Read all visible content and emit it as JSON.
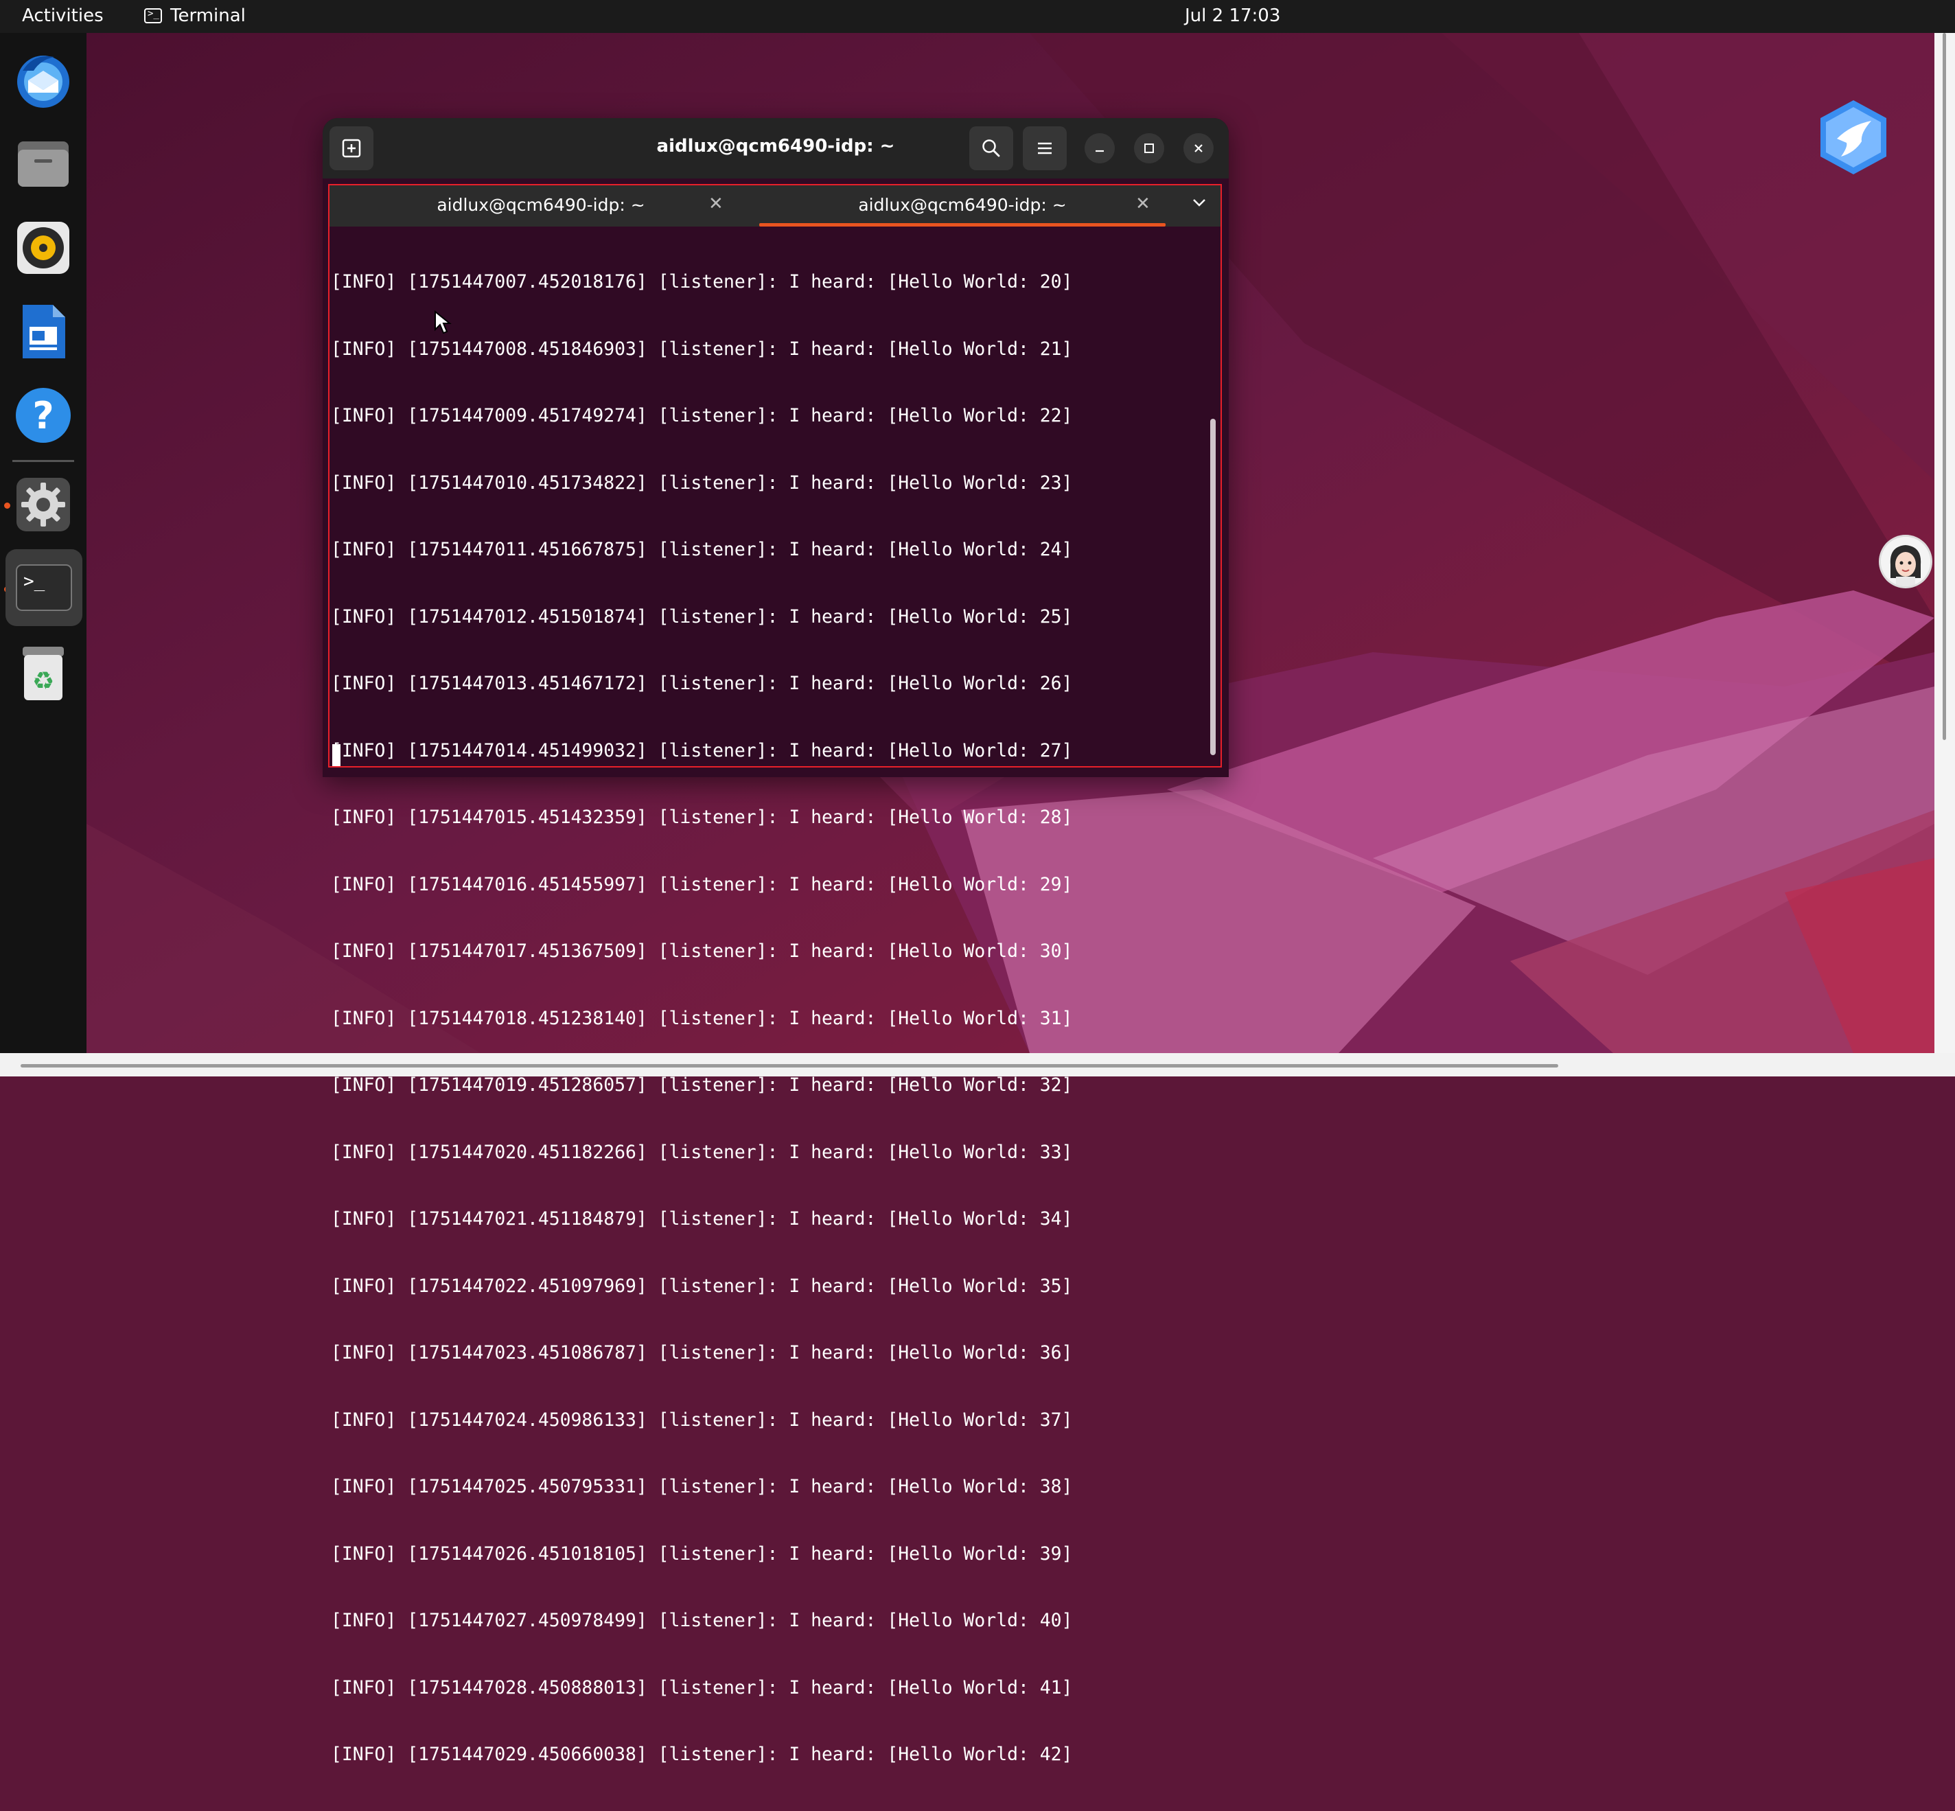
{
  "topbar": {
    "activities_label": "Activities",
    "app_name": "Terminal",
    "clock": "Jul 2  17:03"
  },
  "dock": {
    "items": [
      {
        "name": "thunderbird-icon"
      },
      {
        "name": "files-icon"
      },
      {
        "name": "rhythmbox-icon"
      },
      {
        "name": "writer-icon"
      },
      {
        "name": "help-icon"
      },
      {
        "name": "settings-icon",
        "running": true
      },
      {
        "name": "terminal-icon",
        "running": true,
        "active": true
      },
      {
        "name": "trash-icon"
      }
    ]
  },
  "window": {
    "title": "aidlux@qcm6490-idp: ~",
    "tabs": [
      {
        "label": "aidlux@qcm6490-idp: ~",
        "active": false
      },
      {
        "label": "aidlux@qcm6490-idp: ~",
        "active": true
      }
    ]
  },
  "terminal": {
    "lines": [
      "[INFO] [1751447007.452018176] [listener]: I heard: [Hello World: 20]",
      "[INFO] [1751447008.451846903] [listener]: I heard: [Hello World: 21]",
      "[INFO] [1751447009.451749274] [listener]: I heard: [Hello World: 22]",
      "[INFO] [1751447010.451734822] [listener]: I heard: [Hello World: 23]",
      "[INFO] [1751447011.451667875] [listener]: I heard: [Hello World: 24]",
      "[INFO] [1751447012.451501874] [listener]: I heard: [Hello World: 25]",
      "[INFO] [1751447013.451467172] [listener]: I heard: [Hello World: 26]",
      "[INFO] [1751447014.451499032] [listener]: I heard: [Hello World: 27]",
      "[INFO] [1751447015.451432359] [listener]: I heard: [Hello World: 28]",
      "[INFO] [1751447016.451455997] [listener]: I heard: [Hello World: 29]",
      "[INFO] [1751447017.451367509] [listener]: I heard: [Hello World: 30]",
      "[INFO] [1751447018.451238140] [listener]: I heard: [Hello World: 31]",
      "[INFO] [1751447019.451286057] [listener]: I heard: [Hello World: 32]",
      "[INFO] [1751447020.451182266] [listener]: I heard: [Hello World: 33]",
      "[INFO] [1751447021.451184879] [listener]: I heard: [Hello World: 34]",
      "[INFO] [1751447022.451097969] [listener]: I heard: [Hello World: 35]",
      "[INFO] [1751447023.451086787] [listener]: I heard: [Hello World: 36]",
      "[INFO] [1751447024.450986133] [listener]: I heard: [Hello World: 37]",
      "[INFO] [1751447025.450795331] [listener]: I heard: [Hello World: 38]",
      "[INFO] [1751447026.451018105] [listener]: I heard: [Hello World: 39]",
      "[INFO] [1751447027.450978499] [listener]: I heard: [Hello World: 40]",
      "[INFO] [1751447028.450888013] [listener]: I heard: [Hello World: 41]",
      "[INFO] [1751447029.450660038] [listener]: I heard: [Hello World: 42]"
    ]
  },
  "colors": {
    "accent": "#e95420",
    "terminal_bg": "#300a24",
    "highlight_border": "#e8202a"
  }
}
